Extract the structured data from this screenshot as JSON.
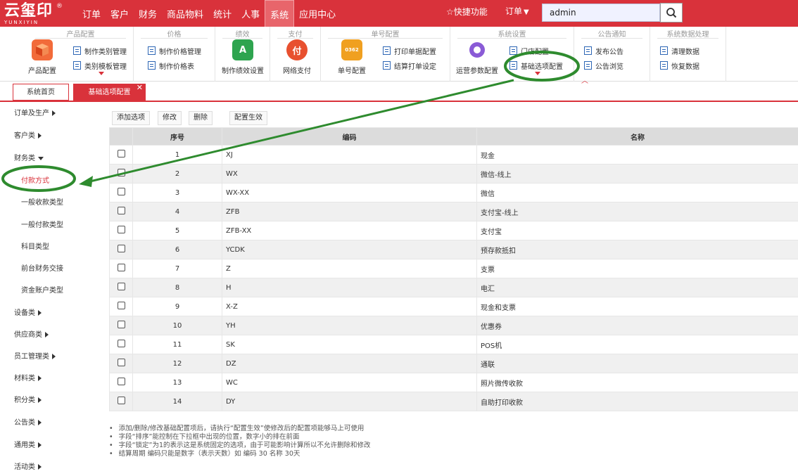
{
  "header": {
    "logo_text": "云玺印",
    "logo_reg": "®",
    "logo_sub": "YUNXIYIN",
    "menu": [
      "订单",
      "客户",
      "财务",
      "商品物料",
      "统计",
      "人事",
      "系统",
      "应用中心"
    ],
    "quick_label": "快捷功能",
    "order_select": "订单",
    "search_value": "admin"
  },
  "ribbon": {
    "groups": [
      {
        "title": "产品配置",
        "big": "产品配置",
        "items": [
          "制作类别管理",
          "类别模板管理"
        ]
      },
      {
        "title": "价格",
        "items": [
          "制作价格管理",
          "制作价格表"
        ]
      },
      {
        "title": "绩效",
        "big": "制作绩效设置"
      },
      {
        "title": "支付",
        "big": "网络支付"
      },
      {
        "title": "单号配置",
        "big": "单号配置",
        "items": [
          "打印单据配置",
          "结算打单设定"
        ]
      },
      {
        "title": "系统设置",
        "big": "运营参数配置",
        "items": [
          "门店配置",
          "基础选项配置"
        ]
      },
      {
        "title": "公告通知",
        "items": [
          "发布公告",
          "公告浏览"
        ]
      },
      {
        "title": "系统数据处理",
        "items": [
          "清理数据",
          "恢复数据"
        ]
      }
    ],
    "icon_number": "0362",
    "icon_pay": "付",
    "icon_perf": "A",
    "collapse": "︿"
  },
  "tabs": [
    {
      "label": "系统首页"
    },
    {
      "label": "基础选项配置",
      "close": "✕"
    }
  ],
  "sidebar": {
    "cats": [
      "订单及生产",
      "客户类",
      "财务类"
    ],
    "finance_items": [
      "付款方式",
      "一般收款类型",
      "一般付款类型",
      "科目类型",
      "前台财务交接",
      "资金账户类型"
    ],
    "cats_after": [
      "设备类",
      "供应商类",
      "员工管理类",
      "材料类",
      "积分类",
      "公告类",
      "通用类",
      "活动类"
    ]
  },
  "toolbar": {
    "add": "添加选项",
    "edit": "修改",
    "delete": "删除",
    "apply": "配置生效"
  },
  "table": {
    "headers": [
      "序号",
      "编码",
      "名称"
    ],
    "rows": [
      {
        "no": "1",
        "code": "XJ",
        "name": "现金"
      },
      {
        "no": "2",
        "code": "WX",
        "name": "微信-线上"
      },
      {
        "no": "3",
        "code": "WX-XX",
        "name": "微信"
      },
      {
        "no": "4",
        "code": "ZFB",
        "name": "支付宝-线上"
      },
      {
        "no": "5",
        "code": "ZFB-XX",
        "name": "支付宝"
      },
      {
        "no": "6",
        "code": "YCDK",
        "name": "预存款抵扣"
      },
      {
        "no": "7",
        "code": "Z",
        "name": "支票"
      },
      {
        "no": "8",
        "code": "H",
        "name": "电汇"
      },
      {
        "no": "9",
        "code": "X-Z",
        "name": "现金和支票"
      },
      {
        "no": "10",
        "code": "YH",
        "name": "优惠券"
      },
      {
        "no": "11",
        "code": "SK",
        "name": "POS机"
      },
      {
        "no": "12",
        "code": "DZ",
        "name": "通联"
      },
      {
        "no": "13",
        "code": "WC",
        "name": "照片微传收款"
      },
      {
        "no": "14",
        "code": "DY",
        "name": "自助打印收款"
      }
    ]
  },
  "notes": [
    "添加/删除/修改基础配置项后，请执行“配置生效”使修改后的配置项能够马上可使用",
    "字段“排序”能控制在下拉框中出现的位置，数字小的排在前面",
    "字段“锁定”为1的表示这是系统固定的选项，由于可能影响计算所以不允许删除和修改",
    "结算周期 编码只能是数字（表示天数）如 编码 30 名称 30天"
  ],
  "colors": {
    "brand": "#d9323b",
    "annotation": "#2e8b2e"
  }
}
